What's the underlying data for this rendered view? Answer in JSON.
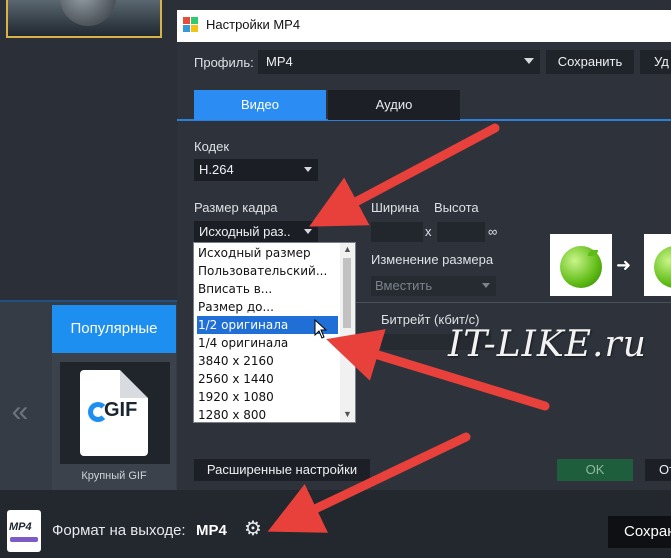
{
  "dialog": {
    "title": "Настройки MP4",
    "profile_label": "Профиль:",
    "profile_value": "MP4",
    "save_label": "Сохранить",
    "delete_label": "Уд"
  },
  "tabs": [
    {
      "label": "Видео",
      "active": true
    },
    {
      "label": "Аудио",
      "active": false
    }
  ],
  "codec": {
    "label": "Кодек",
    "value": "H.264"
  },
  "frame_size": {
    "label": "Размер кадра",
    "value": "Исходный раз..",
    "options": [
      "Исходный размер",
      "Пользовательский...",
      "Вписать в...",
      "Размер до...",
      "1/2 оригинала",
      "1/4 оригинала",
      "3840 x 2160",
      "2560 x 1440",
      "1920 x 1080",
      "1280 x 800"
    ],
    "selected_index": 4
  },
  "dimensions": {
    "width_label": "Ширина",
    "height_label": "Высота",
    "separator": "x"
  },
  "resize": {
    "label": "Изменение размера",
    "value": "Вместить"
  },
  "bitrate": {
    "label": "Битрейт (кбит/с)"
  },
  "footer": {
    "advanced_label": "Расширенные настройки",
    "ok_label": "OK",
    "cancel_label": "От"
  },
  "background_app": {
    "popular_tab": "Популярные",
    "gif_card_label": "Крупный GIF",
    "gif_icon_text": "GIF",
    "nav_prev": "«",
    "output_label": "Формат на выходе:",
    "output_value": "MP4",
    "save_main": "Сохран",
    "mp4_icon_text": "MP4"
  },
  "watermark": "IT-LIKE.ru",
  "colors": {
    "accent": "#2b8df4",
    "annotation_arrow": "#e8403a",
    "selected_item": "#1f6fd6"
  }
}
